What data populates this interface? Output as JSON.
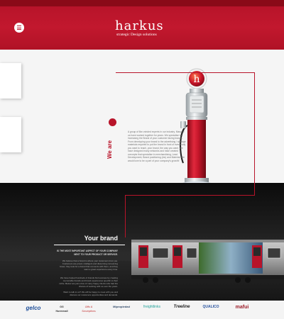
{
  "header": {
    "logo_name": "harkus",
    "logo_tagline": "strategic Design solutions"
  },
  "hero": {
    "heading": "We are",
    "about": "A group of like-minded experts in our industry. Many of us have worked together for years. We specialise in increasing the Brand of your customer facing brands. From developing your brand to the advertising / signage materials required to put the brand in front of everybody you want to reach, your brand, the way you want. We have designed many networks and have created concepts that specialise in merchandising, Lead Development, Brand positioning (etc) and Material. We would love to be a part of your company's growth!"
  },
  "brand": {
    "title": "Your brand",
    "subtitle": "IS THE MOST IMPORTANT ASPECT OF YOUR COMPANY NEXT TO YOUR PRODUCT OR SERVICE.",
    "p1": "We believe that a brand is where your customers trust you. Customers are proud, intelligent and discerning consuming fewer, they look for a brand that connects with them, and they want a great experience every time.",
    "p2": "We have helped hundreds of brands find success by creating memorable brands and brand experiences specific to their niche. Below are just a few of many happy clients who had the chance of working with us over the years.",
    "p3": "Want to talk to us? We will be happy to meet with you and discuss our customers opportunities and demands."
  },
  "clients": [
    {
      "name": "gelco",
      "color": "#1e4f9a"
    },
    {
      "name": "GG Hurenmall",
      "color": "#333333"
    },
    {
      "name": "Gifts & Scrumptions",
      "color": "#c22f2f"
    },
    {
      "name": "Mipropiedad",
      "color": "#334b6a"
    },
    {
      "name": "freightlinks",
      "color": "#25a39a"
    },
    {
      "name": "Treeline",
      "color": "#1f1f1f"
    },
    {
      "name": "QUALICO",
      "color": "#2b55a0"
    },
    {
      "name": "mafui",
      "color": "#9e1f2b"
    }
  ],
  "colors": {
    "brand_red": "#b8142a",
    "dark_bg": "#1e1e1e"
  }
}
